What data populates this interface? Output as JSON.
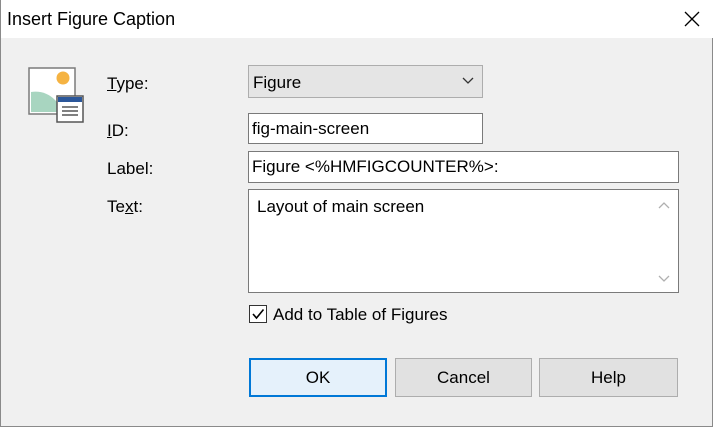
{
  "window": {
    "title": "Insert Figure Caption",
    "close_icon": "close-icon"
  },
  "icon": "figure-caption-icon",
  "form": {
    "type_label": "Type:",
    "type_value": "Figure",
    "id_label": "ID:",
    "id_value": "fig-main-screen",
    "label_label": "Label:",
    "label_value": "Figure <%HMFIGCOUNTER%>:",
    "text_label": "Text:",
    "text_value": "Layout of main screen"
  },
  "checkbox": {
    "label": "Add to Table of Figures",
    "checked": true
  },
  "buttons": {
    "ok": "OK",
    "cancel": "Cancel",
    "help": "Help"
  },
  "colors": {
    "accent": "#0078d7",
    "dialog_bg": "#f0f0f0",
    "button_bg": "#e1e1e1"
  }
}
